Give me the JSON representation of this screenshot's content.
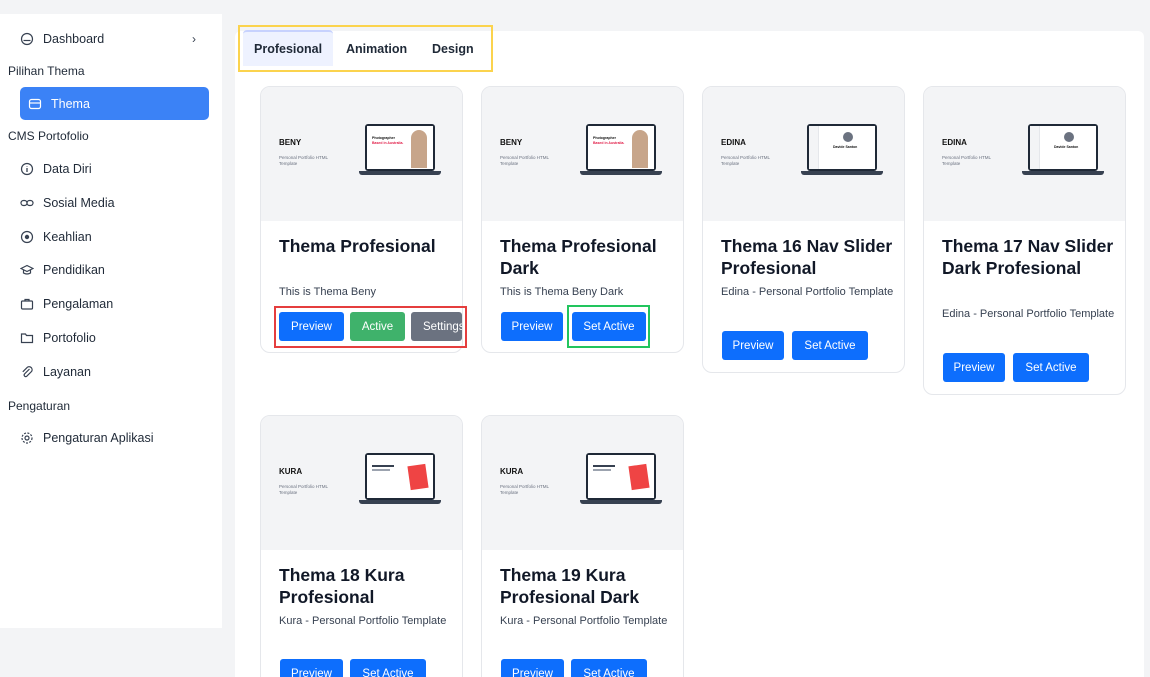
{
  "sidebar": {
    "dashboard": "Dashboard",
    "section_theme": "Pilihan Thema",
    "thema": "Thema",
    "section_cms": "CMS Portofolio",
    "data_diri": "Data Diri",
    "sosial_media": "Sosial Media",
    "keahlian": "Keahlian",
    "pendidikan": "Pendidikan",
    "pengalaman": "Pengalaman",
    "portofolio": "Portofolio",
    "layanan": "Layanan",
    "section_settings": "Pengaturan",
    "pengaturan_aplikasi": "Pengaturan Aplikasi"
  },
  "tabs": [
    "Profesional",
    "Animation",
    "Design"
  ],
  "cards": [
    {
      "brand": "BENY",
      "thumb_sub": "Personal Portfolio HTML Template",
      "title": "Thema Profesional",
      "desc": "This is Thema Beny",
      "btn1": "Preview",
      "btn2": "Active",
      "btn3": "Settings"
    },
    {
      "brand": "BENY",
      "thumb_sub": "Personal Portfolio HTML Template",
      "title": "Thema Profesional Dark",
      "desc": "This is Thema Beny Dark",
      "btn1": "Preview",
      "btn2": "Set Active"
    },
    {
      "brand": "EDINA",
      "thumb_sub": "Personal Portfolio HTML Template",
      "title": "Thema 16 Nav Slider Profesional",
      "desc": "Edina - Personal Portfolio Template",
      "btn1": "Preview",
      "btn2": "Set Active"
    },
    {
      "brand": "EDINA",
      "thumb_sub": "Personal Portfolio HTML Template",
      "title": "Thema 17 Nav Slider Dark Profesional",
      "desc": "Edina - Personal Portfolio Template",
      "btn1": "Preview",
      "btn2": "Set Active"
    },
    {
      "brand": "KURA",
      "thumb_sub": "Personal Portfolio HTML Template",
      "title": "Thema 18 Kura Profesional",
      "desc": "Kura - Personal Portfolio Template",
      "btn1": "Preview",
      "btn2": "Set Active"
    },
    {
      "brand": "KURA",
      "thumb_sub": "Personal Portfolio HTML Template",
      "title": "Thema 19 Kura Profesional Dark",
      "desc": "Kura - Personal Portfolio Template",
      "btn1": "Preview",
      "btn2": "Set Active"
    }
  ],
  "thumb_text": {
    "beny_headline_1": "Photographer",
    "beny_headline_2": "Based in Australia.",
    "edina_name": "Davide Santon"
  }
}
